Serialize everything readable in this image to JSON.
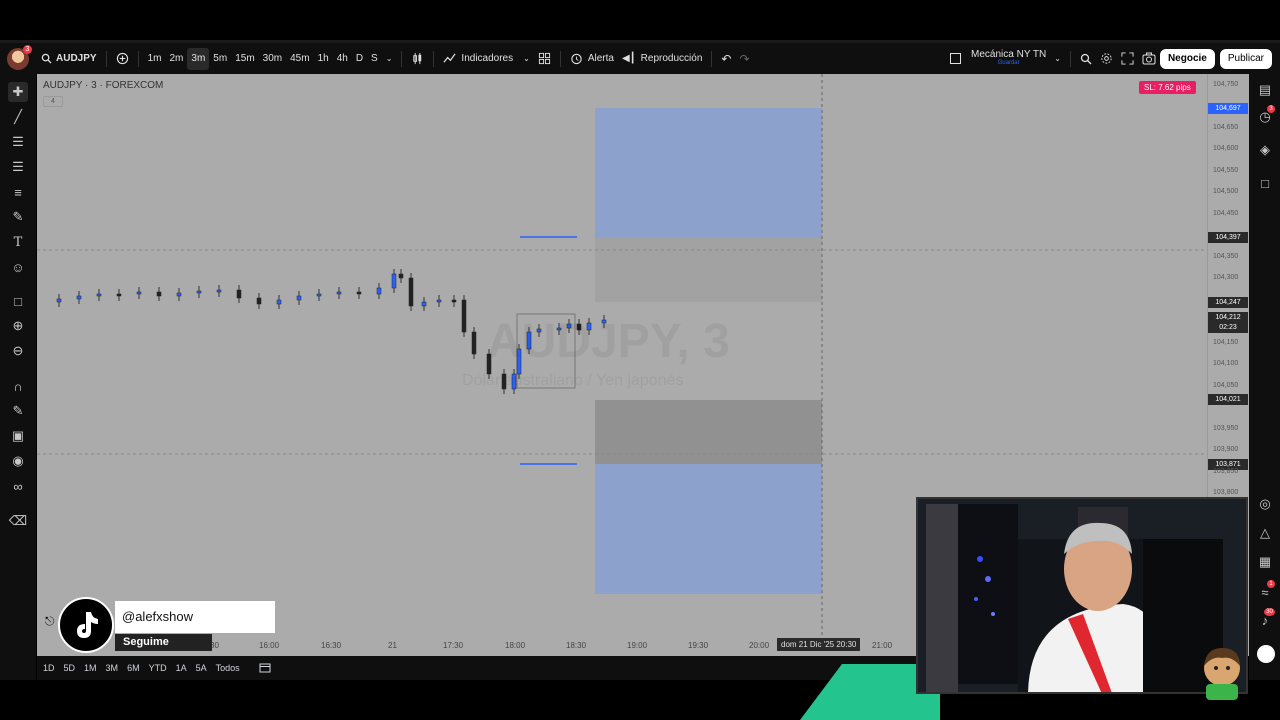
{
  "toolbar": {
    "symbol": "AUDJPY",
    "timeframes": [
      "1m",
      "2m",
      "3m",
      "5m",
      "15m",
      "30m",
      "45m",
      "1h",
      "4h",
      "D",
      "S"
    ],
    "active_timeframe": "3m",
    "indicators_label": "Indicadores",
    "alert_label": "Alerta",
    "replay_label": "Reproducción",
    "layout_name": "Mecánica NY TN",
    "layout_sub": "Guardar",
    "trade_label": "Negocie",
    "publish_label": "Publicar",
    "notif_count": "3"
  },
  "chart": {
    "title": "AUDJPY · 3 · FOREXCOM",
    "badge": "4",
    "sl_badge": "SL: 7.62 pips",
    "watermark": "AUDJPY, 3",
    "watermark_sub": "Dólar australiano / Yen japonés",
    "price_labels": [
      "104,750",
      "104,650",
      "104,600",
      "104,550",
      "104,500",
      "104,450",
      "104,350",
      "104,300",
      "104,150",
      "104,100",
      "104,050",
      "103,950",
      "103,900",
      "103,850",
      "103,800"
    ],
    "price_tags": [
      {
        "text": "104,697",
        "color": "#2962ff"
      },
      {
        "text": "104,397",
        "color": "#2a2a2a"
      },
      {
        "text": "104,247",
        "color": "#2a2a2a"
      },
      {
        "text": "104,212",
        "color": "#2a2a2a"
      },
      {
        "text": "02:23",
        "color": "#2a2a2a"
      },
      {
        "text": "104,021",
        "color": "#2a2a2a"
      },
      {
        "text": "103,871",
        "color": "#2a2a2a"
      }
    ],
    "time_labels": [
      "30",
      "16:00",
      "16:30",
      "21",
      "17:30",
      "18:00",
      "18:30",
      "19:00",
      "19:30",
      "20:00",
      "21:00"
    ],
    "crosshair_time": "dom 21 Dic '25   20:30"
  },
  "bottom_bar": {
    "ranges": [
      "1D",
      "5D",
      "1M",
      "3M",
      "6M",
      "YTD",
      "1A",
      "5A",
      "Todos"
    ]
  },
  "overlay": {
    "handle": "@alefxshow",
    "follow": "Seguime"
  },
  "right_sidebar": {
    "badge_alerts": "3",
    "badge_notif": "1",
    "badge_count": "30"
  }
}
